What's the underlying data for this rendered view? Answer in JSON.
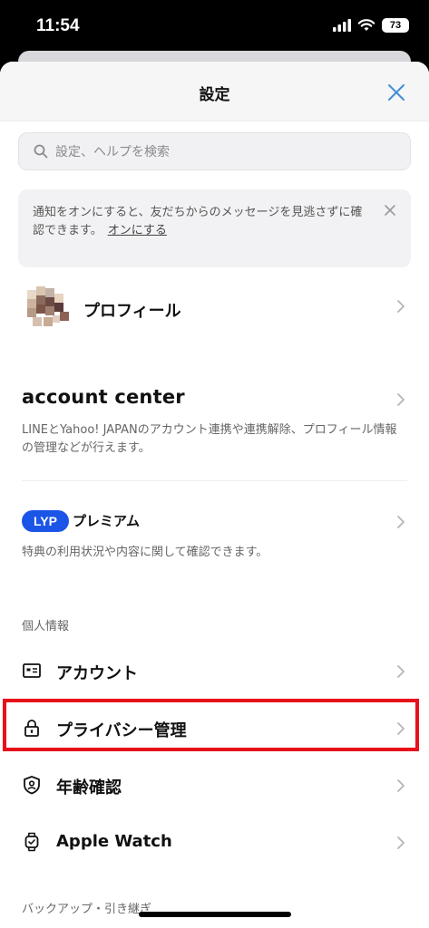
{
  "status_bar": {
    "time": "11:54",
    "battery": "73"
  },
  "sheet": {
    "title": "設定"
  },
  "search": {
    "placeholder": "設定、ヘルプを検索"
  },
  "notice": {
    "text": "通知をオンにすると、友だちからのメッセージを見逃さずに確認できます。",
    "link": "オンにする"
  },
  "profile": {
    "label": "プロフィール"
  },
  "account_center": {
    "title": "account center",
    "description": "LINEとYahoo! JAPANのアカウント連携や連携解除、プロフィール情報の管理などが行えます。"
  },
  "lyp": {
    "badge": "LYP",
    "title": "プレミアム",
    "description": "特典の利用状況や内容に関して確認できます。"
  },
  "sections": {
    "personal": "個人情報",
    "backup": "バックアップ・引き継ぎ"
  },
  "menu": {
    "account": "アカウント",
    "privacy": "プライバシー管理",
    "age": "年齢確認",
    "watch": "Apple Watch"
  }
}
